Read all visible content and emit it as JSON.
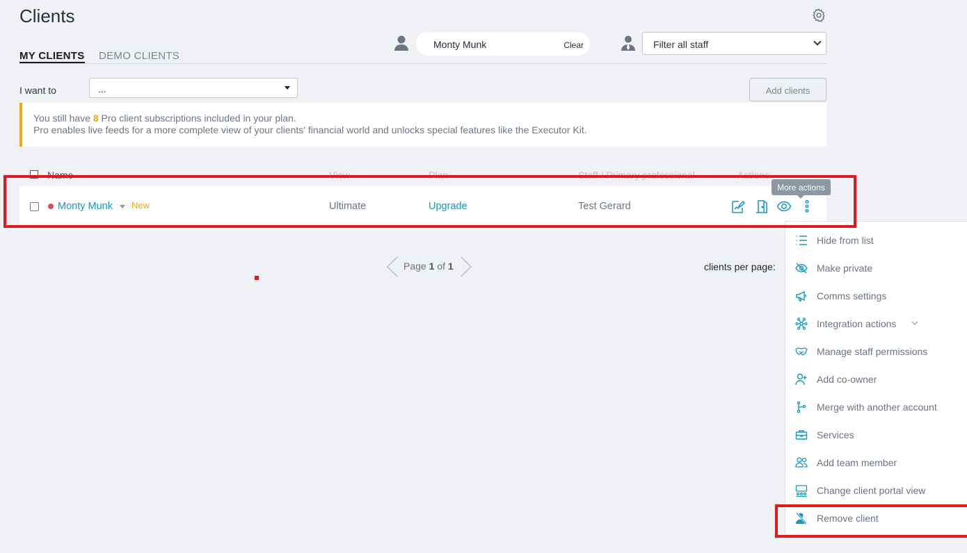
{
  "page": {
    "title": "Clients"
  },
  "tabs": [
    {
      "label": "MY CLIENTS",
      "active": true
    },
    {
      "label": "DEMO CLIENTS",
      "active": false
    }
  ],
  "client_filter": {
    "value": "Monty Munk",
    "clear_label": "Clear"
  },
  "staff_filter": {
    "value": "Filter all staff"
  },
  "iwant": {
    "label": "I want to",
    "value": "..."
  },
  "add_clients_label": "Add clients",
  "banner": {
    "line1_pre": "You still have ",
    "count": "8",
    "line1_post": " Pro client subscriptions included in your plan.",
    "line2": "Pro enables live feeds for a more complete view of your clients' financial world and unlocks special features like the Executor Kit."
  },
  "table": {
    "headers": {
      "name": "Name",
      "view": "View",
      "plan": "Plan",
      "staff": "Staff / Primary professional",
      "actions": "Actions"
    },
    "row": {
      "name": "Monty Munk",
      "badge": "New",
      "view": "Ultimate",
      "plan": "Upgrade",
      "staff": "Test Gerard"
    }
  },
  "tooltip": "More actions",
  "pager": {
    "prefix": "Page ",
    "current": "1",
    "mid": " of ",
    "total": "1"
  },
  "per_page_label": "clients per page:",
  "menu": {
    "items": [
      {
        "label": "Hide from list",
        "icon": "list-icon"
      },
      {
        "label": "Make private",
        "icon": "eye-slash-icon"
      },
      {
        "label": "Comms settings",
        "icon": "megaphone-icon"
      },
      {
        "label": "Integration actions",
        "icon": "network-icon"
      },
      {
        "label": "Manage staff permissions",
        "icon": "handshake-icon"
      },
      {
        "label": "Add co-owner",
        "icon": "user-plus-icon"
      },
      {
        "label": "Merge with another account",
        "icon": "merge-icon"
      },
      {
        "label": "Services",
        "icon": "briefcase-icon"
      },
      {
        "label": "Add team member",
        "icon": "team-icon"
      },
      {
        "label": "Change client portal view",
        "icon": "portal-view-icon"
      },
      {
        "label": "Remove client",
        "icon": "user-remove-icon"
      }
    ]
  },
  "colors": {
    "accent": "#1596c4",
    "warning": "#f5a60c",
    "highlight": "#e0191e",
    "background": "#eff1f4"
  }
}
